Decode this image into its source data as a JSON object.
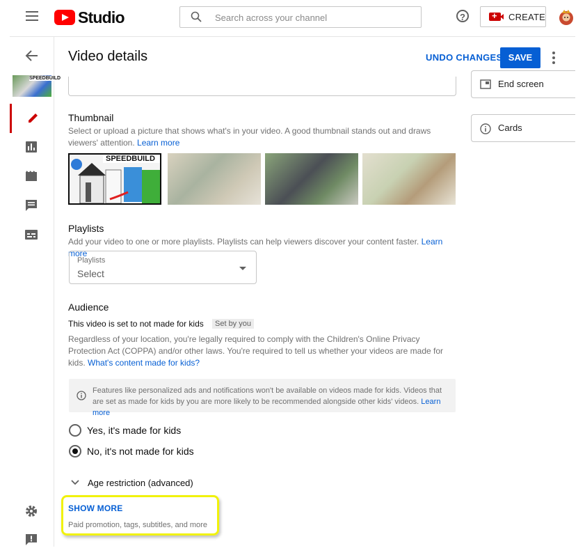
{
  "app": {
    "logo_text": "Studio"
  },
  "topbar": {
    "search_placeholder": "Search across your channel",
    "create_label": "CREATE"
  },
  "rail": {
    "thumbnail_caption": "SPEEDBUILD",
    "items": [
      "edit-icon",
      "analytics-icon",
      "editor-icon",
      "comments-icon",
      "subtitles-icon",
      "settings-icon",
      "feedback-icon"
    ]
  },
  "header": {
    "title": "Video details",
    "undo_label": "UNDO CHANGES",
    "save_label": "SAVE"
  },
  "thumbnail": {
    "title": "Thumbnail",
    "desc": "Select or upload a picture that shows what's in your video. A good thumbnail stands out and draws viewers' attention.",
    "learn_more": "Learn more",
    "selected_caption": "SPEEDBUILD"
  },
  "playlists": {
    "title": "Playlists",
    "desc": "Add your video to one or more playlists. Playlists can help viewers discover your content faster.",
    "learn_more": "Learn more",
    "field_label": "Playlists",
    "field_value": "Select"
  },
  "audience": {
    "title": "Audience",
    "status": "This video is set to not made for kids",
    "chip": "Set by you",
    "desc": "Regardless of your location, you're legally required to comply with the Children's Online Privacy Protection Act (COPPA) and/or other laws. You're required to tell us whether your videos are made for kids.",
    "whats_content_link": "What's content made for kids?",
    "notice": "Features like personalized ads and notifications won't be available on videos made for kids. Videos that are set as made for kids by you are more likely to be recommended alongside other kids' videos.",
    "notice_link": "Learn more",
    "option_yes": "Yes, it's made for kids",
    "option_no": "No, it's not made for kids",
    "selected": "no",
    "age_restriction": "Age restriction (advanced)"
  },
  "show_more": {
    "label": "SHOW MORE",
    "sub": "Paid promotion, tags, subtitles, and more"
  },
  "side": {
    "end_screen": "End screen",
    "cards": "Cards"
  },
  "colors": {
    "accent": "#065fd4",
    "brand_red": "#ff0000",
    "highlight": "#f1f20b"
  }
}
